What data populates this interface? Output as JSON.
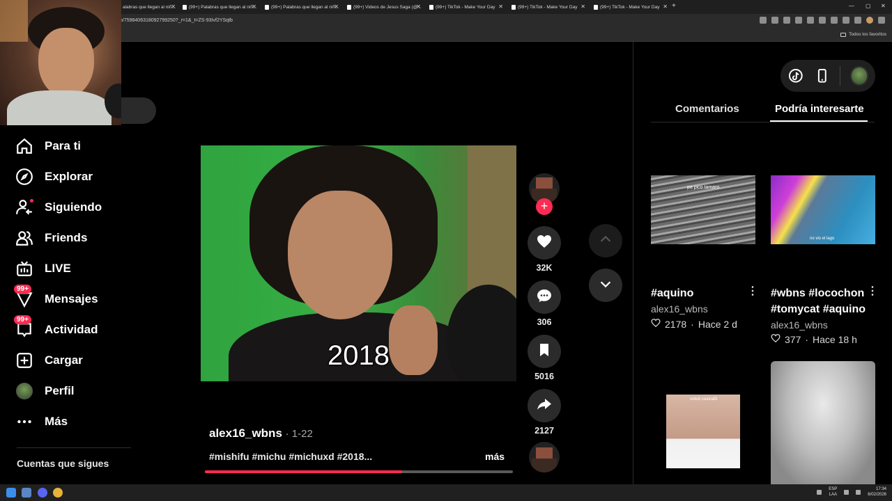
{
  "browser": {
    "tabs": [
      {
        "title": "alabras que llegan al niñ..."
      },
      {
        "title": "(99+) Palabras que llegan al niñ..."
      },
      {
        "title": "(99+) Palabras que llegan al niñ..."
      },
      {
        "title": "(99+) Videos de Jesus Saga (@..."
      },
      {
        "title": "(99+) TikTok - Make Your Day"
      },
      {
        "title": "(99+) TikTok - Make Your Day"
      },
      {
        "title": "(99+) TikTok - Make Your Day"
      },
      {
        "title": "(99+) TikTok - Make Your Day"
      }
    ],
    "new_tab": "+",
    "url": "o/7598406318092799250?_r=1&_t=ZS-93Ivf2YSqtb",
    "bookmarks_label": "Todos los favoritos"
  },
  "sidebar": {
    "items": [
      {
        "label": "Para ti",
        "icon": "home-icon"
      },
      {
        "label": "Explorar",
        "icon": "compass-icon"
      },
      {
        "label": "Siguiendo",
        "icon": "following-icon"
      },
      {
        "label": "Friends",
        "icon": "friends-icon"
      },
      {
        "label": "LIVE",
        "icon": "live-icon"
      },
      {
        "label": "Mensajes",
        "icon": "messages-icon",
        "badge": "99+"
      },
      {
        "label": "Actividad",
        "icon": "activity-icon",
        "badge": "99+"
      },
      {
        "label": "Cargar",
        "icon": "upload-icon"
      },
      {
        "label": "Perfil",
        "icon": "avatar"
      },
      {
        "label": "Más",
        "icon": "more-icon"
      }
    ],
    "following_title": "Cuentas que sigues"
  },
  "video": {
    "caption_overlay": "2018",
    "author": "alex16_wbns",
    "date": "· 1-22",
    "description": "#mishifu #michu #michuxd #2018...",
    "more_label": "más",
    "progress": 0.64
  },
  "actions": {
    "follow_plus": "+",
    "likes": "32K",
    "comments": "306",
    "saves": "5016",
    "shares": "2127"
  },
  "right_panel": {
    "tabs": [
      {
        "label": "Comentarios"
      },
      {
        "label": "Podría interesarte"
      }
    ],
    "cards": [
      {
        "thumb_label": "pa pico tamaro",
        "title": "#aquino",
        "user": "alex16_wbns",
        "likes": "2178",
        "age": "Hace 2 d"
      },
      {
        "thumb_label": "no vio el lago",
        "title_line1": "#wbns #locochon",
        "title_line2": "#tomycat #aquino",
        "user": "alex16_wbns",
        "likes": "377",
        "age": "Hace 18 h"
      },
      {
        "thumb_label": "volvió casicaBi"
      },
      {
        "thumb_label": ""
      }
    ],
    "separator": "·"
  },
  "taskbar": {
    "lang_line1": "ESP",
    "lang_line2": "LAA",
    "time": "17:34",
    "date": "6/02/2026"
  },
  "colors": {
    "accent": "#fe2c55",
    "background": "#000000",
    "button_bg": "#2b2b2b"
  }
}
